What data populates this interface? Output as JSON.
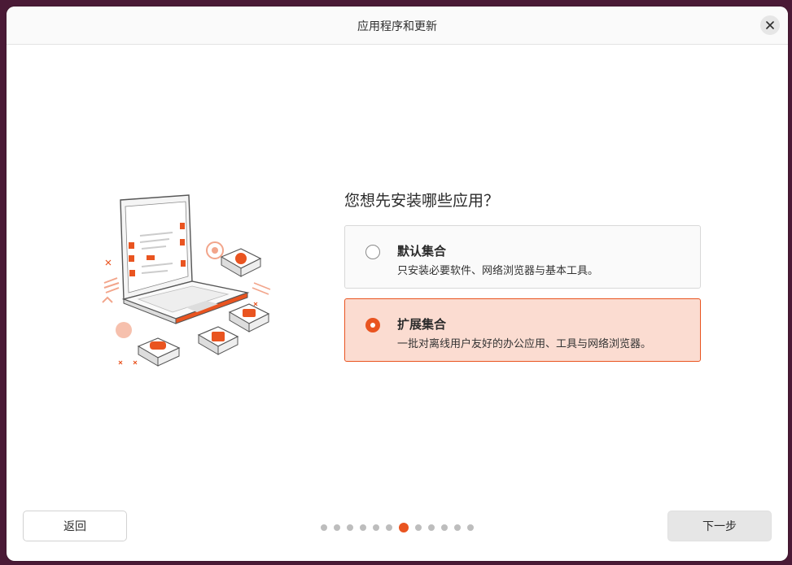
{
  "window": {
    "title": "应用程序和更新"
  },
  "main": {
    "question": "您想先安装哪些应用？",
    "options": [
      {
        "title": "默认集合",
        "description": "只安装必要软件、网络浏览器与基本工具。",
        "selected": false
      },
      {
        "title": "扩展集合",
        "description": "一批对离线用户友好的办公应用、工具与网络浏览器。",
        "selected": true
      }
    ]
  },
  "footer": {
    "back_label": "返回",
    "next_label": "下一步",
    "progress": {
      "total_steps": 12,
      "current_step": 7
    }
  },
  "colors": {
    "accent": "#e95420",
    "selected_bg": "#fbdcd1"
  },
  "icons": [
    "close-icon",
    "laptop-illustration"
  ]
}
